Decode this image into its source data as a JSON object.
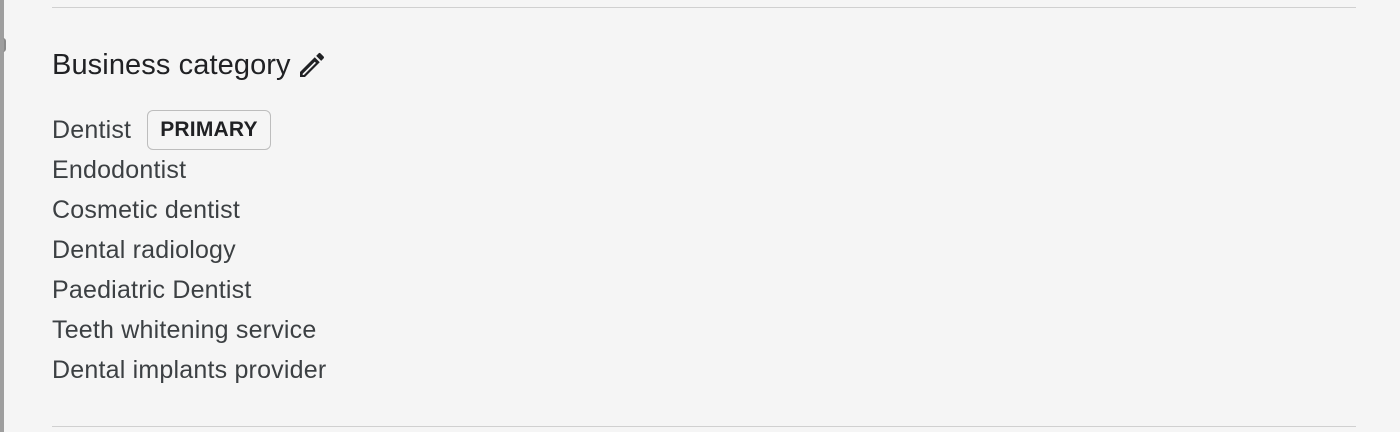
{
  "section": {
    "title": "Business category",
    "edit_icon": "pencil-icon"
  },
  "categories": [
    {
      "label": "Dentist",
      "badge": "PRIMARY"
    },
    {
      "label": "Endodontist"
    },
    {
      "label": "Cosmetic dentist"
    },
    {
      "label": "Dental radiology"
    },
    {
      "label": "Paediatric Dentist"
    },
    {
      "label": "Teeth whitening service"
    },
    {
      "label": "Dental implants provider"
    }
  ],
  "colors": {
    "background": "#f5f5f5",
    "text": "#3c4043",
    "divider": "#d0d0d0"
  }
}
